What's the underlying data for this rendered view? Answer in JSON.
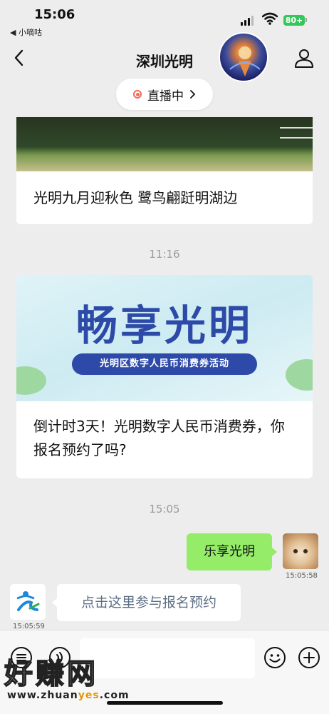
{
  "status": {
    "time": "15:06",
    "back_app": "◀ 小嘀咕",
    "battery": "80+"
  },
  "header": {
    "title": "深圳光明",
    "live_label": "直播中"
  },
  "messages": {
    "card1_caption": "光明九月迎秋色 鹭鸟翩跹明湖边",
    "time1": "11:16",
    "card2_banner_title": "畅享光明",
    "card2_banner_sub": "光明区数字人民币消费券活动",
    "card2_caption": "倒计时3天！光明数字人民币消费券，你报名预约了吗?",
    "time2": "15:05",
    "out_text": "乐享光明",
    "out_time": "15:05:58",
    "in_text": "点击这里参与报名预约",
    "in_time": "15:05:59"
  },
  "watermark": {
    "main": "好赚网",
    "url_pre": "www.zhuan",
    "url_hl": "yes",
    "url_post": ".com"
  },
  "colors": {
    "bubble_out": "#95ec69",
    "live_dot": "#f36b5c",
    "banner_blue": "#2d4aa8",
    "battery": "#34c759"
  },
  "icons": [
    "back-chevron-icon",
    "user-icon",
    "live-dot-icon",
    "chevron-right-icon",
    "voice-icon",
    "emoji-icon",
    "plus-icon"
  ]
}
